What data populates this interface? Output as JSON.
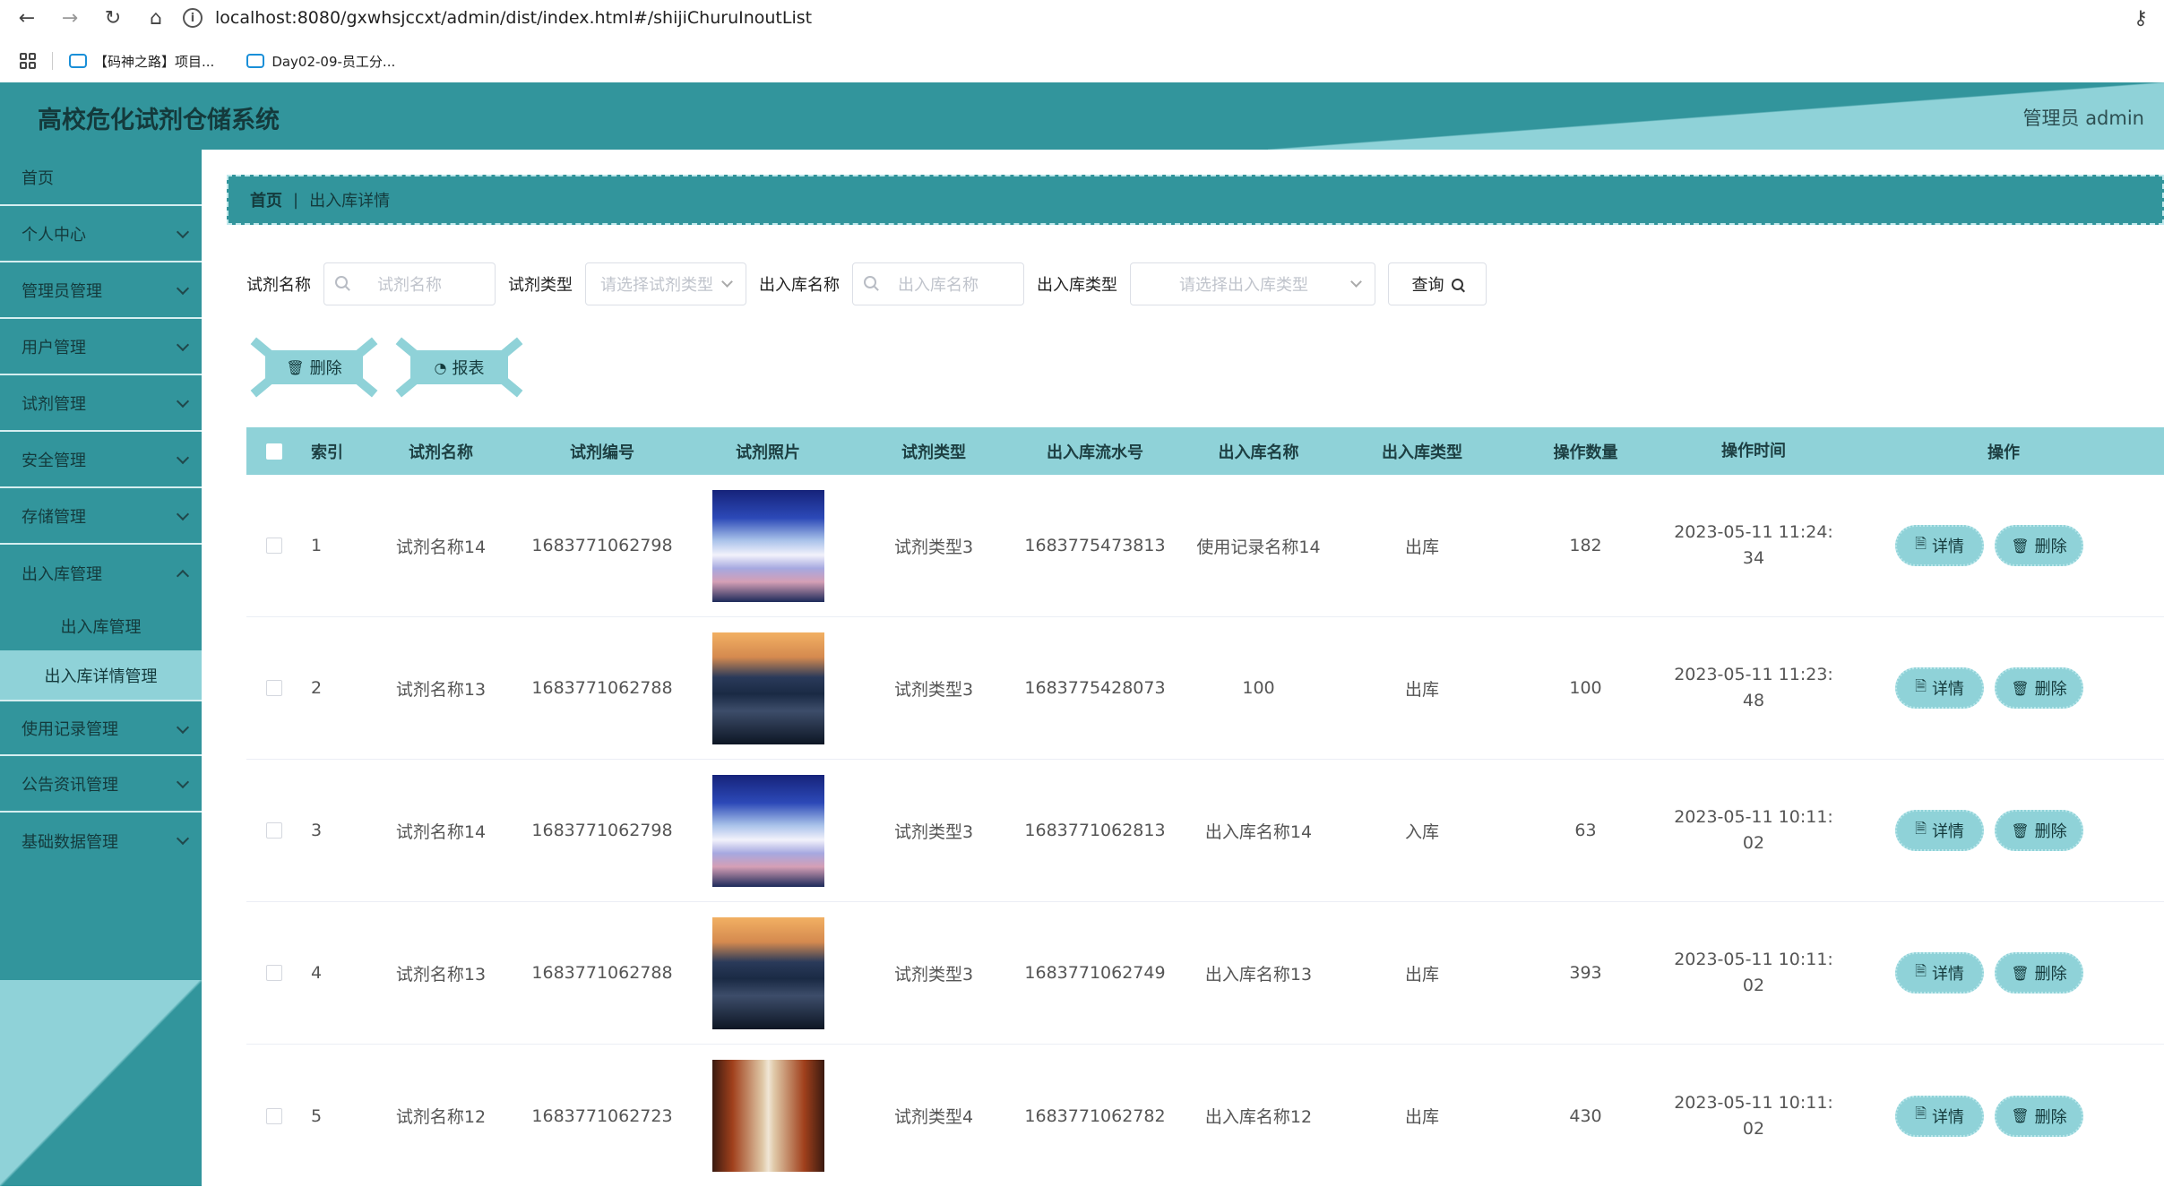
{
  "browser": {
    "url": "localhost:8080/gxwhsjccxt/admin/dist/index.html#/shijiChuruInoutList",
    "bookmarks": [
      "【码神之路】项目...",
      "Day02-09-员工分..."
    ]
  },
  "header": {
    "title": "高校危化试剂仓储系统",
    "user": "管理员 admin"
  },
  "sidebar": {
    "items": [
      {
        "label": "首页"
      },
      {
        "label": "个人中心"
      },
      {
        "label": "管理员管理"
      },
      {
        "label": "用户管理"
      },
      {
        "label": "试剂管理"
      },
      {
        "label": "安全管理"
      },
      {
        "label": "存储管理"
      },
      {
        "label": "出入库管理"
      }
    ],
    "subitems": [
      {
        "label": "出入库管理"
      },
      {
        "label": "出入库详情管理"
      }
    ],
    "items_after": [
      {
        "label": "使用记录管理"
      },
      {
        "label": "公告资讯管理"
      },
      {
        "label": "基础数据管理"
      }
    ]
  },
  "breadcrumb": {
    "home": "首页",
    "sep": "|",
    "current": "出入库详情"
  },
  "filters": {
    "name_label": "试剂名称",
    "name_placeholder": "试剂名称",
    "type_label": "试剂类型",
    "type_placeholder": "请选择试剂类型",
    "ioname_label": "出入库名称",
    "ioname_placeholder": "出入库名称",
    "iotype_label": "出入库类型",
    "iotype_placeholder": "请选择出入库类型",
    "query_label": "查询"
  },
  "actions": {
    "delete_label": "删除",
    "report_label": "报表"
  },
  "table": {
    "headers": {
      "index": "索引",
      "name": "试剂名称",
      "code": "试剂编号",
      "photo": "试剂照片",
      "type": "试剂类型",
      "serial": "出入库流水号",
      "ioname": "出入库名称",
      "iotype": "出入库类型",
      "qty": "操作数量",
      "time": "操作时间",
      "ops": "操作"
    },
    "detail_label": "详情",
    "delete_label": "删除",
    "rows": [
      {
        "index": "1",
        "name": "试剂名称14",
        "code": "1683771062798",
        "photo": "sky",
        "type": "试剂类型3",
        "serial": "1683775473813",
        "ioname": "使用记录名称14",
        "iotype": "出库",
        "qty": "182",
        "time_date": "2023-05-11 11:24:",
        "time_sec": "34"
      },
      {
        "index": "2",
        "name": "试剂名称13",
        "code": "1683771062788",
        "photo": "city",
        "type": "试剂类型3",
        "serial": "1683775428073",
        "ioname": "100",
        "iotype": "出库",
        "qty": "100",
        "time_date": "2023-05-11 11:23:",
        "time_sec": "48"
      },
      {
        "index": "3",
        "name": "试剂名称14",
        "code": "1683771062798",
        "photo": "sky",
        "type": "试剂类型3",
        "serial": "1683771062813",
        "ioname": "出入库名称14",
        "iotype": "入库",
        "qty": "63",
        "time_date": "2023-05-11 10:11:",
        "time_sec": "02"
      },
      {
        "index": "4",
        "name": "试剂名称13",
        "code": "1683771062788",
        "photo": "city",
        "type": "试剂类型3",
        "serial": "1683771062749",
        "ioname": "出入库名称13",
        "iotype": "出库",
        "qty": "393",
        "time_date": "2023-05-11 10:11:",
        "time_sec": "02"
      },
      {
        "index": "5",
        "name": "试剂名称12",
        "code": "1683771062723",
        "photo": "hall",
        "type": "试剂类型4",
        "serial": "1683771062782",
        "ioname": "出入库名称12",
        "iotype": "出库",
        "qty": "430",
        "time_date": "2023-05-11 10:11:",
        "time_sec": "02"
      }
    ]
  },
  "colors": {
    "primary": "#32959c",
    "light": "#8fd2d8"
  }
}
